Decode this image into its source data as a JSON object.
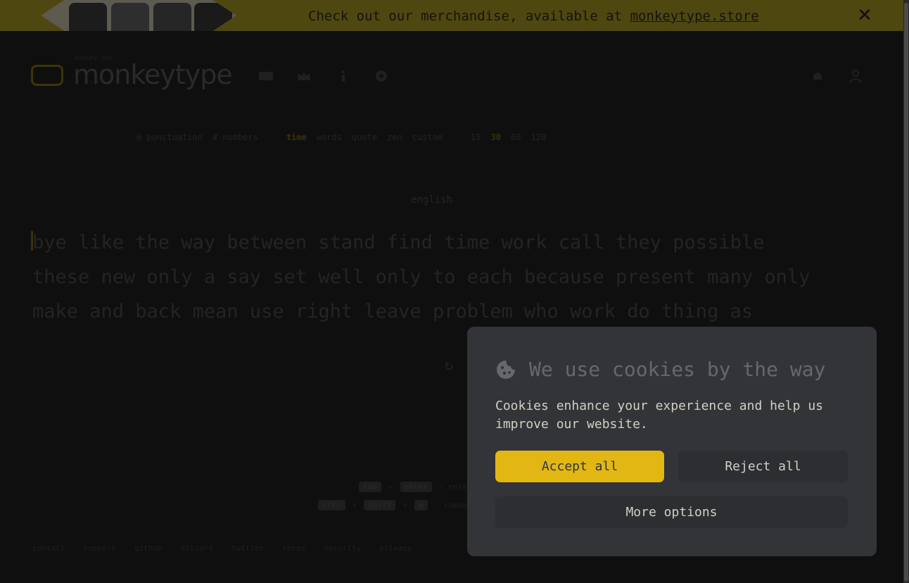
{
  "banner": {
    "text": "Check out our merchandise, available at ",
    "link": "monkeytype.store",
    "close": "✕"
  },
  "header": {
    "logo_text": "monkeytype",
    "logo_subtitle": "monkey see"
  },
  "config": {
    "items": [
      "@ punctuation",
      "# numbers",
      "time",
      "words",
      "quote",
      "zen",
      "custom",
      "15",
      "30",
      "60",
      "120"
    ],
    "active_mode": "time",
    "active_duration": "30"
  },
  "test": {
    "language": "english",
    "lines": [
      "bye like the way between stand find time work call they possible",
      "these new only a say set well only to each because present many only",
      "make and back mean use right leave problem who work do thing as"
    ],
    "restart_icon": "↻"
  },
  "hints": {
    "row1": [
      "tab",
      "+",
      "enter",
      "- restart test"
    ],
    "row2": [
      "ctrl",
      "+",
      "shift",
      "+",
      "p",
      "- command line"
    ]
  },
  "footer": {
    "links": [
      "contact",
      "support",
      "github",
      "discord",
      "twitter",
      "terms",
      "security",
      "privacy"
    ]
  },
  "cookie": {
    "title": "We use cookies by the way",
    "body": "Cookies enhance your experience and help us improve our website.",
    "accept": "Accept all",
    "reject": "Reject all",
    "more": "More options"
  },
  "colors": {
    "accent": "#e2b714",
    "modal_bg": "#323437",
    "button_bg": "#2c2e31",
    "text": "#d1d0c5",
    "page_bg": "#0f0f0f"
  }
}
